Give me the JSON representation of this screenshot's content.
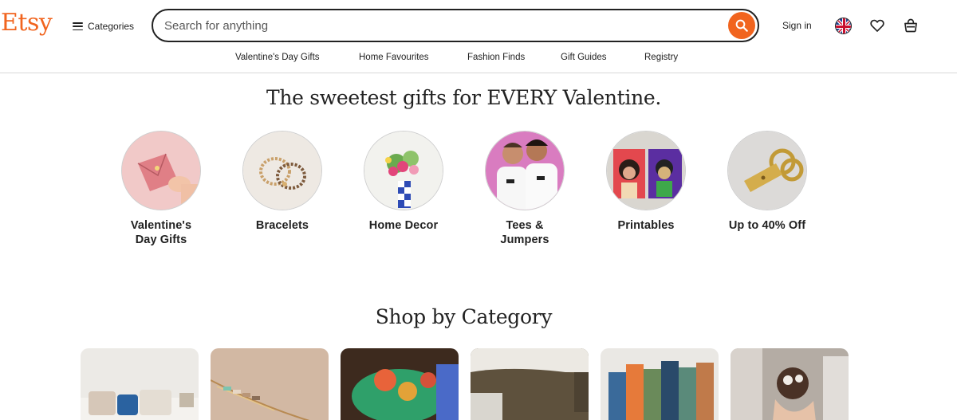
{
  "header": {
    "logo": "Etsy",
    "categories_label": "Categories",
    "search_placeholder": "Search for anything",
    "signin_label": "Sign in"
  },
  "subnav": [
    "Valentine's Day Gifts",
    "Home Favourites",
    "Fashion Finds",
    "Gift Guides",
    "Registry"
  ],
  "hero": {
    "title": "The sweetest gifts for EVERY Valentine.",
    "items": [
      "Valentine's\nDay Gifts",
      "Bracelets",
      "Home Decor",
      "Tees &\nJumpers",
      "Printables",
      "Up to 40% Off"
    ]
  },
  "shop_by_category": {
    "title": "Shop by Category"
  },
  "colors": {
    "brand": "#f1641e",
    "text": "#222222"
  }
}
